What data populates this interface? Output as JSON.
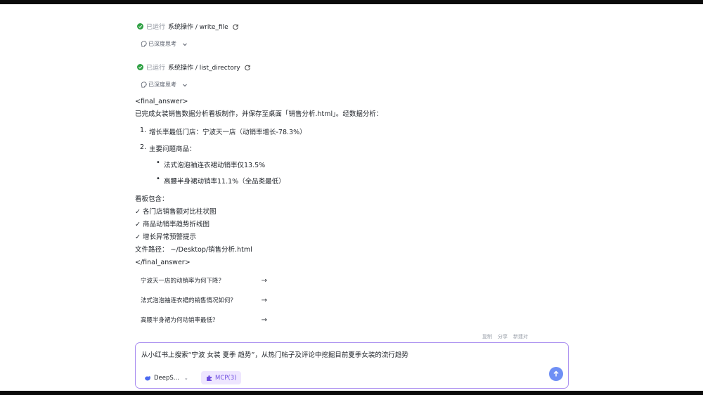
{
  "tool_calls": [
    {
      "status": "已运行",
      "name": "系统操作 / write_file",
      "thinking_label": "已深度思考"
    },
    {
      "status": "已运行",
      "name": "系统操作 / list_directory",
      "thinking_label": "已深度思考"
    }
  ],
  "answer": {
    "open_tag": "<final_answer>",
    "summary": "已完成女装销售数据分析看板制作，并保存至桌面「销售分析.html」。经数据分析：",
    "item1_num": "1.",
    "item1_text": "增长率最低门店：宁波天一店（动销率增长-78.3%）",
    "item2_num": "2.",
    "item2_text": "主要问题商品：",
    "bullets": [
      "法式泡泡袖连衣裙动销率仅13.5%",
      "高腰半身裙动销率11.1%（全品类最低）"
    ],
    "board_title": "看板包含：",
    "board_items": [
      "✓ 各门店销售额对比柱状图",
      "✓ 商品动销率趋势折线图",
      "✓ 增长异常预警提示"
    ],
    "file_path": "文件路径： ~/Desktop/销售分析.html",
    "close_tag": "</final_answer>"
  },
  "suggestions": [
    {
      "text": "宁波天一店的动销率为何下降？",
      "arrow": "→"
    },
    {
      "text": "法式泡泡袖连衣裙的销售情况如何？",
      "arrow": "→"
    },
    {
      "text": "高腰半身裙为何动销率最低？",
      "arrow": "→"
    }
  ],
  "message_actions": [
    "复制",
    "分享",
    "新建对"
  ],
  "composer": {
    "input_value": "从小红书上搜索“宁波 女装 夏季 趋势”，从热门帖子及评论中挖掘目前夏季女装的流行趋势",
    "model_label": "DeepS...",
    "mcp_label": "MCP(3)"
  },
  "colors": {
    "accent": "#a98df0",
    "mcp_bg": "#eee6ff",
    "mcp_text": "#6f4ee0",
    "success": "#2ea043",
    "send": "#6f8ff5"
  }
}
